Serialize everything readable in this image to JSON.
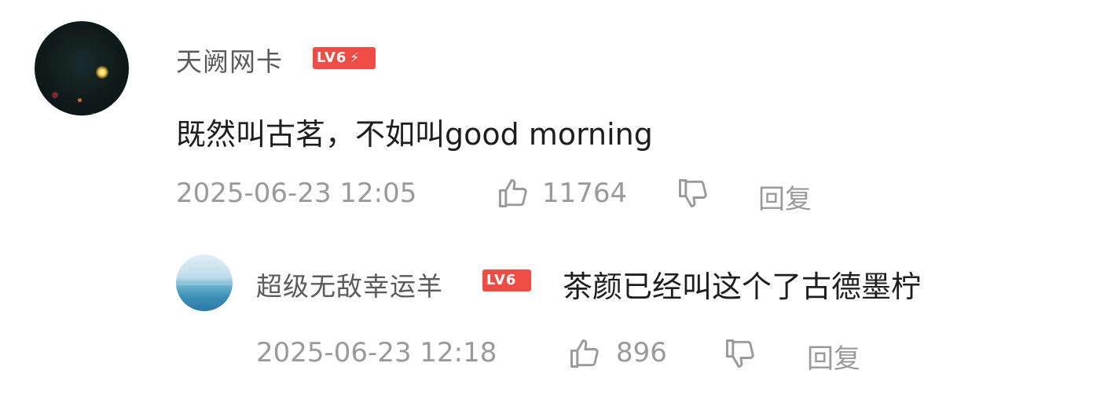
{
  "comment": {
    "username": "天阙网卡",
    "level": "LV6",
    "content": "既然叫古茗，不如叫good morning",
    "time": "2025-06-23 12:05",
    "likes": "11764",
    "reply_label": "回复"
  },
  "reply": {
    "username": "超级无敌幸运羊",
    "level": "LV6",
    "content": "茶颜已经叫这个了古德墨柠",
    "time": "2025-06-23 12:18",
    "likes": "896",
    "reply_label": "回复"
  },
  "colors": {
    "level_badge": "#f04c46",
    "meta_text": "#9a9a9a",
    "username_text": "#5b5b5b",
    "content_text": "#1e1e1e"
  },
  "icons": {
    "like": "thumbs-up-icon",
    "dislike": "thumbs-down-icon",
    "level_bolt": "lightning-icon"
  }
}
